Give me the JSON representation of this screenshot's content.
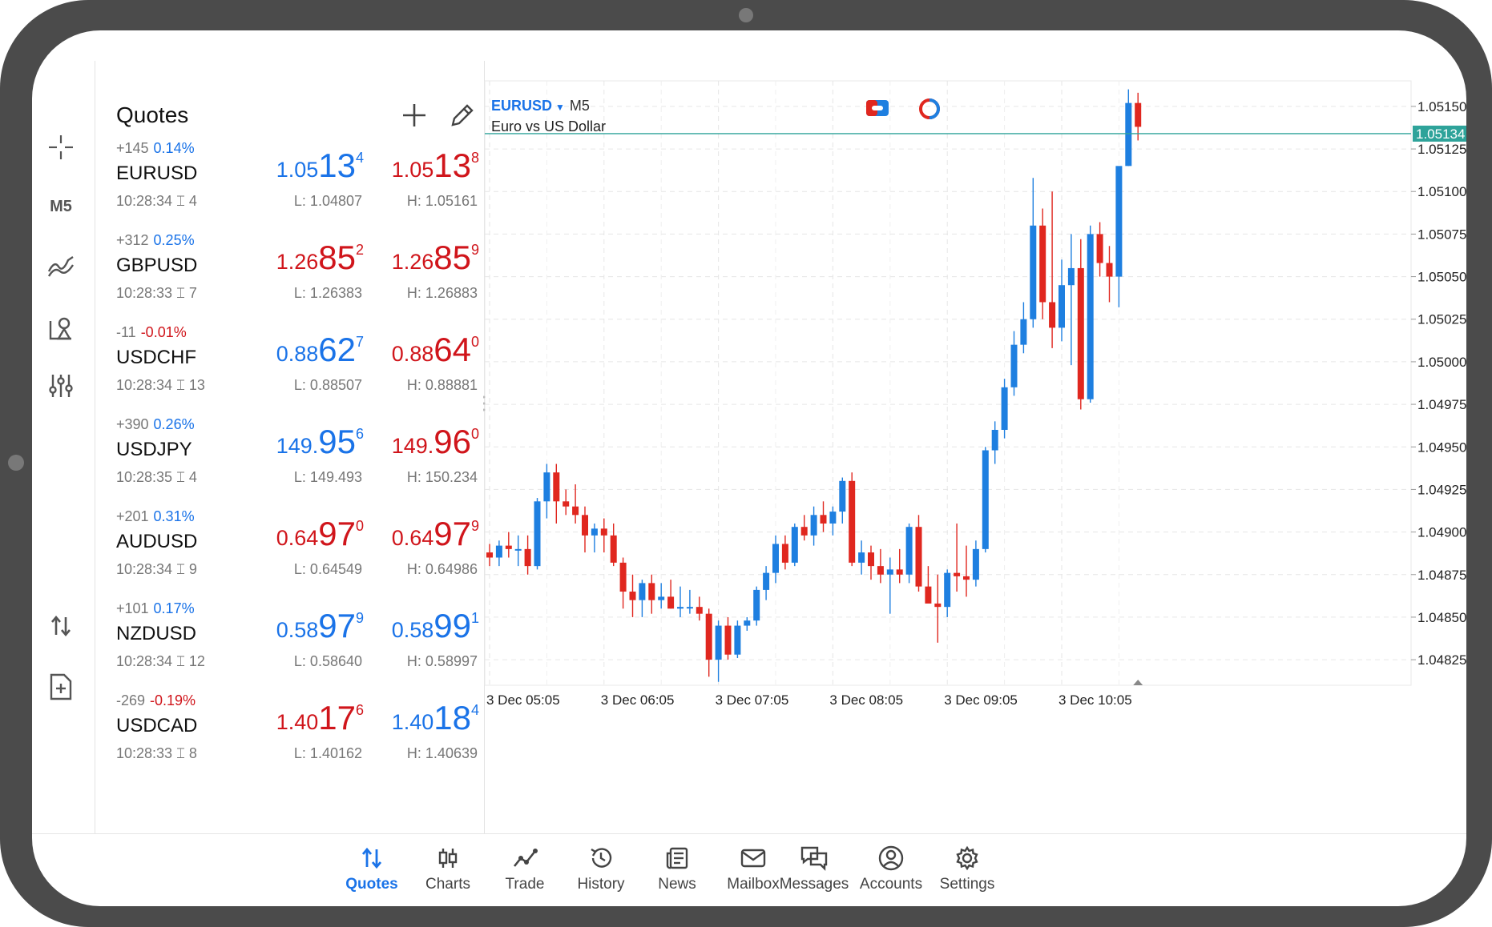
{
  "toolbar": {
    "items": [
      {
        "name": "crosshair-icon"
      },
      {
        "label": "M5"
      },
      {
        "name": "indicators-icon"
      },
      {
        "name": "objects-icon"
      },
      {
        "name": "settings-sliders-icon"
      },
      {
        "name": "trade-arrows-icon"
      },
      {
        "name": "new-document-icon"
      }
    ]
  },
  "quotes": {
    "title": "Quotes",
    "rows": [
      {
        "chg": "+145",
        "pct": "0.14%",
        "dir": "up",
        "symbol": "EURUSD",
        "time": "10:28:34",
        "spread": "4",
        "bid": {
          "a": "1.05",
          "b": "13",
          "c": "4",
          "dir": "up"
        },
        "ask": {
          "a": "1.05",
          "b": "13",
          "c": "8",
          "dir": "down"
        },
        "low": "L: 1.04807",
        "high": "H: 1.05161"
      },
      {
        "chg": "+312",
        "pct": "0.25%",
        "dir": "up",
        "symbol": "GBPUSD",
        "time": "10:28:33",
        "spread": "7",
        "bid": {
          "a": "1.26",
          "b": "85",
          "c": "2",
          "dir": "down"
        },
        "ask": {
          "a": "1.26",
          "b": "85",
          "c": "9",
          "dir": "down"
        },
        "low": "L: 1.26383",
        "high": "H: 1.26883"
      },
      {
        "chg": "-11",
        "pct": "-0.01%",
        "dir": "down",
        "symbol": "USDCHF",
        "time": "10:28:34",
        "spread": "13",
        "bid": {
          "a": "0.88",
          "b": "62",
          "c": "7",
          "dir": "up"
        },
        "ask": {
          "a": "0.88",
          "b": "64",
          "c": "0",
          "dir": "down"
        },
        "low": "L: 0.88507",
        "high": "H: 0.88881"
      },
      {
        "chg": "+390",
        "pct": "0.26%",
        "dir": "up",
        "symbol": "USDJPY",
        "time": "10:28:35",
        "spread": "4",
        "bid": {
          "a": "149.",
          "b": "95",
          "c": "6",
          "dir": "up"
        },
        "ask": {
          "a": "149.",
          "b": "96",
          "c": "0",
          "dir": "down"
        },
        "low": "L: 149.493",
        "high": "H: 150.234"
      },
      {
        "chg": "+201",
        "pct": "0.31%",
        "dir": "up",
        "symbol": "AUDUSD",
        "time": "10:28:34",
        "spread": "9",
        "bid": {
          "a": "0.64",
          "b": "97",
          "c": "0",
          "dir": "down"
        },
        "ask": {
          "a": "0.64",
          "b": "97",
          "c": "9",
          "dir": "down"
        },
        "low": "L: 0.64549",
        "high": "H: 0.64986"
      },
      {
        "chg": "+101",
        "pct": "0.17%",
        "dir": "up",
        "symbol": "NZDUSD",
        "time": "10:28:34",
        "spread": "12",
        "bid": {
          "a": "0.58",
          "b": "97",
          "c": "9",
          "dir": "up"
        },
        "ask": {
          "a": "0.58",
          "b": "99",
          "c": "1",
          "dir": "up"
        },
        "low": "L: 0.58640",
        "high": "H: 0.58997"
      },
      {
        "chg": "-269",
        "pct": "-0.19%",
        "dir": "down",
        "symbol": "USDCAD",
        "time": "10:28:33",
        "spread": "8",
        "bid": {
          "a": "1.40",
          "b": "17",
          "c": "6",
          "dir": "down"
        },
        "ask": {
          "a": "1.40",
          "b": "18",
          "c": "4",
          "dir": "up"
        },
        "low": "L: 1.40162",
        "high": "H: 1.40639"
      }
    ]
  },
  "chart": {
    "symbol": "EURUSD",
    "timeframe": "M5",
    "description": "Euro vs US Dollar",
    "current_price": "1.05134",
    "y_labels": [
      "1.05150",
      "1.05125",
      "1.05100",
      "1.05075",
      "1.05050",
      "1.05025",
      "1.05000",
      "1.04975",
      "1.04950",
      "1.04925",
      "1.04900",
      "1.04875",
      "1.04850",
      "1.04825"
    ],
    "x_labels": [
      "3 Dec 05:05",
      "3 Dec 06:05",
      "3 Dec 07:05",
      "3 Dec 08:05",
      "3 Dec 09:05",
      "3 Dec 10:05"
    ],
    "up_color": "#1e7fe0",
    "down_color": "#e0271f",
    "bid_line_color": "#2ea39a"
  },
  "chart_data": {
    "type": "candlestick",
    "ylim": [
      1.0481,
      1.05165
    ],
    "candles": [
      [
        1.04888,
        1.04893,
        1.0488,
        1.04885
      ],
      [
        1.04885,
        1.04895,
        1.0488,
        1.04892
      ],
      [
        1.04892,
        1.049,
        1.04885,
        1.0489
      ],
      [
        1.0489,
        1.04898,
        1.0488,
        1.0489
      ],
      [
        1.0489,
        1.04898,
        1.04875,
        1.0488
      ],
      [
        1.0488,
        1.0492,
        1.04878,
        1.04918
      ],
      [
        1.04918,
        1.0494,
        1.04908,
        1.04935
      ],
      [
        1.04935,
        1.0494,
        1.04905,
        1.04918
      ],
      [
        1.04918,
        1.04925,
        1.0491,
        1.04915
      ],
      [
        1.04915,
        1.04928,
        1.04905,
        1.0491
      ],
      [
        1.0491,
        1.04915,
        1.04888,
        1.04898
      ],
      [
        1.04898,
        1.04905,
        1.04888,
        1.04902
      ],
      [
        1.04902,
        1.04908,
        1.04888,
        1.04898
      ],
      [
        1.04898,
        1.04905,
        1.0488,
        1.04882
      ],
      [
        1.04882,
        1.04885,
        1.04855,
        1.04865
      ],
      [
        1.04865,
        1.04875,
        1.0485,
        1.0486
      ],
      [
        1.0486,
        1.04872,
        1.0485,
        1.0487
      ],
      [
        1.0487,
        1.04875,
        1.04852,
        1.0486
      ],
      [
        1.0486,
        1.0487,
        1.04855,
        1.04862
      ],
      [
        1.04862,
        1.04872,
        1.04855,
        1.04855
      ],
      [
        1.04855,
        1.04868,
        1.0485,
        1.04856
      ],
      [
        1.04856,
        1.04866,
        1.04852,
        1.04856
      ],
      [
        1.04856,
        1.04862,
        1.04848,
        1.04852
      ],
      [
        1.04852,
        1.04855,
        1.04815,
        1.04825
      ],
      [
        1.04825,
        1.04848,
        1.04812,
        1.04845
      ],
      [
        1.04845,
        1.0485,
        1.04825,
        1.04828
      ],
      [
        1.04828,
        1.04848,
        1.04826,
        1.04845
      ],
      [
        1.04845,
        1.0485,
        1.04842,
        1.04848
      ],
      [
        1.04848,
        1.04868,
        1.04845,
        1.04866
      ],
      [
        1.04866,
        1.0488,
        1.0486,
        1.04876
      ],
      [
        1.04876,
        1.04898,
        1.0487,
        1.04893
      ],
      [
        1.04893,
        1.04898,
        1.04878,
        1.04882
      ],
      [
        1.04882,
        1.04905,
        1.0488,
        1.04903
      ],
      [
        1.04903,
        1.0491,
        1.04895,
        1.04898
      ],
      [
        1.04898,
        1.04915,
        1.04892,
        1.0491
      ],
      [
        1.0491,
        1.04918,
        1.049,
        1.04905
      ],
      [
        1.04905,
        1.04915,
        1.04898,
        1.04912
      ],
      [
        1.04912,
        1.04932,
        1.04905,
        1.0493
      ],
      [
        1.0493,
        1.04935,
        1.0488,
        1.04882
      ],
      [
        1.04882,
        1.04895,
        1.04875,
        1.04888
      ],
      [
        1.04888,
        1.04892,
        1.04872,
        1.0488
      ],
      [
        1.0488,
        1.0489,
        1.0487,
        1.04875
      ],
      [
        1.04875,
        1.04885,
        1.04852,
        1.04878
      ],
      [
        1.04878,
        1.0489,
        1.0487,
        1.04875
      ],
      [
        1.04875,
        1.04905,
        1.0487,
        1.04903
      ],
      [
        1.04903,
        1.0491,
        1.04865,
        1.04868
      ],
      [
        1.04868,
        1.0488,
        1.0486,
        1.04858
      ],
      [
        1.04858,
        1.04875,
        1.04835,
        1.04856
      ],
      [
        1.04856,
        1.04878,
        1.0485,
        1.04876
      ],
      [
        1.04876,
        1.04905,
        1.04865,
        1.04874
      ],
      [
        1.04874,
        1.04892,
        1.04862,
        1.04872
      ],
      [
        1.04872,
        1.04895,
        1.04868,
        1.0489
      ],
      [
        1.0489,
        1.0495,
        1.04888,
        1.04948
      ],
      [
        1.04948,
        1.04965,
        1.0494,
        1.0496
      ],
      [
        1.0496,
        1.0499,
        1.04955,
        1.04985
      ],
      [
        1.04985,
        1.05018,
        1.0498,
        1.0501
      ],
      [
        1.0501,
        1.05035,
        1.05005,
        1.05025
      ],
      [
        1.05025,
        1.05108,
        1.0502,
        1.0508
      ],
      [
        1.0508,
        1.0509,
        1.05025,
        1.05035
      ],
      [
        1.05035,
        1.051,
        1.05008,
        1.0502
      ],
      [
        1.0502,
        1.0506,
        1.05012,
        1.05045
      ],
      [
        1.05045,
        1.05075,
        1.04998,
        1.05055
      ],
      [
        1.05055,
        1.05072,
        1.04972,
        1.04978
      ],
      [
        1.04978,
        1.0508,
        1.04976,
        1.05075
      ],
      [
        1.05075,
        1.05082,
        1.0505,
        1.05058
      ],
      [
        1.05058,
        1.05068,
        1.05035,
        1.0505
      ],
      [
        1.0505,
        1.05105,
        1.05032,
        1.05115
      ],
      [
        1.05115,
        1.0516,
        1.05115,
        1.05152
      ],
      [
        1.05152,
        1.05158,
        1.0513,
        1.05138
      ]
    ]
  },
  "nav": {
    "items": [
      {
        "label": "Quotes",
        "icon": "quotes-icon",
        "active": true
      },
      {
        "label": "Charts",
        "icon": "charts-icon"
      },
      {
        "label": "Trade",
        "icon": "trade-icon"
      },
      {
        "label": "History",
        "icon": "history-icon"
      },
      {
        "label": "News",
        "icon": "news-icon"
      },
      {
        "label": "Mailbox",
        "icon": "mailbox-icon"
      },
      {
        "label": "Messages",
        "icon": "messages-icon"
      },
      {
        "label": "Accounts",
        "icon": "accounts-icon"
      },
      {
        "label": "Settings",
        "icon": "settings-icon"
      }
    ]
  }
}
